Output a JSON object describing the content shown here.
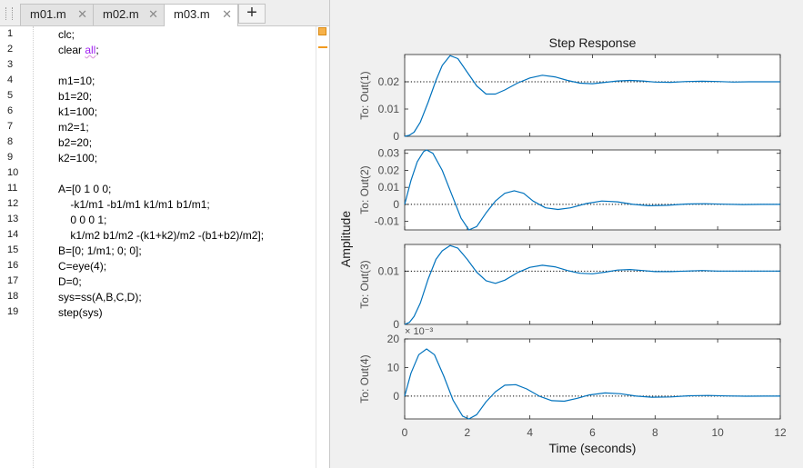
{
  "editor": {
    "tabs": [
      {
        "label": "m01.m",
        "active": false
      },
      {
        "label": "m02.m",
        "active": false
      },
      {
        "label": "m03.m",
        "active": true
      }
    ],
    "close_glyph": "✕",
    "add_tab_glyph": "+",
    "lines": [
      {
        "n": "1",
        "text": "clc;"
      },
      {
        "n": "2",
        "text": "clear ",
        "str": "all",
        "tail": ";"
      },
      {
        "n": "3",
        "text": ""
      },
      {
        "n": "4",
        "text": "m1=10;"
      },
      {
        "n": "5",
        "text": "b1=20;"
      },
      {
        "n": "6",
        "text": "k1=100;"
      },
      {
        "n": "7",
        "text": "m2=1;"
      },
      {
        "n": "8",
        "text": "b2=20;"
      },
      {
        "n": "9",
        "text": "k2=100;"
      },
      {
        "n": "10",
        "text": ""
      },
      {
        "n": "11",
        "text": "A=[0 1 0 0;"
      },
      {
        "n": "12",
        "text": "    -k1/m1 -b1/m1 k1/m1 b1/m1;"
      },
      {
        "n": "13",
        "text": "    0 0 0 1;"
      },
      {
        "n": "14",
        "text": "    k1/m2 b1/m2 -(k1+k2)/m2 -(b1+b2)/m2];"
      },
      {
        "n": "15",
        "text": "B=[0; 1/m1; 0; 0];"
      },
      {
        "n": "16",
        "text": "C=eye(4);"
      },
      {
        "n": "17",
        "text": "D=0;"
      },
      {
        "n": "18",
        "text": "sys=ss(A,B,C,D);"
      },
      {
        "n": "19",
        "text": "step(sys)"
      }
    ],
    "string_color": "#a020f0",
    "warning_color": "#f29a1e"
  },
  "chart_data": {
    "type": "line",
    "title": "Step Response",
    "xlabel": "Time (seconds)",
    "ylabel": "Amplitude",
    "xlim": [
      0,
      12
    ],
    "xticks": [
      "0",
      "2",
      "4",
      "6",
      "8",
      "10",
      "12"
    ],
    "line_color": "#0072bd",
    "steady_state_line": "dotted",
    "subplots": [
      {
        "name": "To: Out(1)",
        "ylim": [
          0,
          0.03
        ],
        "yticks": [
          {
            "v": 0,
            "label": "0"
          },
          {
            "v": 0.01,
            "label": "0.01"
          },
          {
            "v": 0.02,
            "label": "0.02"
          }
        ],
        "final_value": 0.02,
        "exponent_label": "",
        "points": [
          [
            0,
            0
          ],
          [
            0.15,
            0.0004
          ],
          [
            0.3,
            0.0015
          ],
          [
            0.5,
            0.0052
          ],
          [
            0.75,
            0.0125
          ],
          [
            1.0,
            0.0205
          ],
          [
            1.2,
            0.026
          ],
          [
            1.45,
            0.0296
          ],
          [
            1.7,
            0.0285
          ],
          [
            2.0,
            0.0235
          ],
          [
            2.3,
            0.0185
          ],
          [
            2.6,
            0.0155
          ],
          [
            2.9,
            0.0155
          ],
          [
            3.2,
            0.017
          ],
          [
            3.6,
            0.0195
          ],
          [
            4.0,
            0.0214
          ],
          [
            4.4,
            0.0224
          ],
          [
            4.8,
            0.0218
          ],
          [
            5.2,
            0.0205
          ],
          [
            5.6,
            0.0195
          ],
          [
            6.0,
            0.0193
          ],
          [
            6.4,
            0.0198
          ],
          [
            6.8,
            0.0203
          ],
          [
            7.2,
            0.0205
          ],
          [
            7.6,
            0.0203
          ],
          [
            8.0,
            0.0199
          ],
          [
            8.5,
            0.0198
          ],
          [
            9.0,
            0.0201
          ],
          [
            9.5,
            0.0202
          ],
          [
            10.0,
            0.0201
          ],
          [
            10.5,
            0.0199
          ],
          [
            11.0,
            0.02
          ],
          [
            11.5,
            0.02
          ],
          [
            12.0,
            0.02
          ]
        ]
      },
      {
        "name": "To: Out(2)",
        "ylim": [
          -0.015,
          0.032
        ],
        "yticks": [
          {
            "v": -0.01,
            "label": "-0.01"
          },
          {
            "v": 0,
            "label": "0"
          },
          {
            "v": 0.01,
            "label": "0.01"
          },
          {
            "v": 0.02,
            "label": "0.02"
          },
          {
            "v": 0.03,
            "label": "0.03"
          }
        ],
        "final_value": 0,
        "exponent_label": "",
        "points": [
          [
            0,
            0
          ],
          [
            0.2,
            0.014
          ],
          [
            0.4,
            0.025
          ],
          [
            0.6,
            0.031
          ],
          [
            0.7,
            0.032
          ],
          [
            0.9,
            0.03
          ],
          [
            1.2,
            0.02
          ],
          [
            1.5,
            0.006
          ],
          [
            1.8,
            -0.008
          ],
          [
            2.05,
            -0.015
          ],
          [
            2.3,
            -0.013
          ],
          [
            2.6,
            -0.005
          ],
          [
            2.9,
            0.002
          ],
          [
            3.2,
            0.0065
          ],
          [
            3.5,
            0.008
          ],
          [
            3.8,
            0.0065
          ],
          [
            4.1,
            0.002
          ],
          [
            4.5,
            -0.002
          ],
          [
            4.9,
            -0.003
          ],
          [
            5.3,
            -0.002
          ],
          [
            5.8,
            0.0005
          ],
          [
            6.3,
            0.002
          ],
          [
            6.8,
            0.0015
          ],
          [
            7.3,
            0
          ],
          [
            7.8,
            -0.0008
          ],
          [
            8.4,
            -0.0005
          ],
          [
            9.0,
            0.0002
          ],
          [
            9.6,
            0.0004
          ],
          [
            10.2,
            0.0001
          ],
          [
            10.8,
            -0.0001
          ],
          [
            11.4,
            0
          ],
          [
            12.0,
            0
          ]
        ]
      },
      {
        "name": "To: Out(3)",
        "ylim": [
          0,
          0.015
        ],
        "yticks": [
          {
            "v": 0,
            "label": "0"
          },
          {
            "v": 0.01,
            "label": "0.01"
          }
        ],
        "final_value": 0.01,
        "exponent_label": "",
        "points": [
          [
            0,
            0
          ],
          [
            0.15,
            0.0004
          ],
          [
            0.3,
            0.0015
          ],
          [
            0.5,
            0.004
          ],
          [
            0.75,
            0.0085
          ],
          [
            1.0,
            0.0122
          ],
          [
            1.2,
            0.0138
          ],
          [
            1.45,
            0.0148
          ],
          [
            1.7,
            0.0143
          ],
          [
            2.0,
            0.0122
          ],
          [
            2.3,
            0.0098
          ],
          [
            2.6,
            0.0082
          ],
          [
            2.9,
            0.0077
          ],
          [
            3.2,
            0.0083
          ],
          [
            3.6,
            0.0097
          ],
          [
            4.0,
            0.0107
          ],
          [
            4.4,
            0.0111
          ],
          [
            4.8,
            0.0108
          ],
          [
            5.2,
            0.0101
          ],
          [
            5.6,
            0.0096
          ],
          [
            6.0,
            0.0095
          ],
          [
            6.4,
            0.0098
          ],
          [
            6.8,
            0.0102
          ],
          [
            7.2,
            0.0103
          ],
          [
            7.6,
            0.0101
          ],
          [
            8.0,
            0.0099
          ],
          [
            8.5,
            0.0099
          ],
          [
            9.0,
            0.01
          ],
          [
            9.5,
            0.0101
          ],
          [
            10.0,
            0.01
          ],
          [
            10.5,
            0.01
          ],
          [
            11.0,
            0.01
          ],
          [
            11.5,
            0.01
          ],
          [
            12.0,
            0.01
          ]
        ]
      },
      {
        "name": "To: Out(4)",
        "ylim": [
          -8,
          20
        ],
        "yticks": [
          {
            "v": 0,
            "label": "0"
          },
          {
            "v": 10,
            "label": "10"
          },
          {
            "v": 20,
            "label": "20"
          }
        ],
        "final_value": 0,
        "exponent_label": "× 10⁻³",
        "points": [
          [
            0,
            0
          ],
          [
            0.2,
            8
          ],
          [
            0.45,
            14.5
          ],
          [
            0.7,
            16.5
          ],
          [
            0.95,
            14.5
          ],
          [
            1.25,
            7
          ],
          [
            1.55,
            -1.5
          ],
          [
            1.85,
            -7
          ],
          [
            2.05,
            -8
          ],
          [
            2.3,
            -6.5
          ],
          [
            2.6,
            -2
          ],
          [
            2.9,
            1.5
          ],
          [
            3.2,
            3.8
          ],
          [
            3.55,
            4
          ],
          [
            3.9,
            2.5
          ],
          [
            4.3,
            0
          ],
          [
            4.7,
            -1.6
          ],
          [
            5.1,
            -1.8
          ],
          [
            5.5,
            -0.8
          ],
          [
            5.9,
            0.4
          ],
          [
            6.4,
            1.1
          ],
          [
            6.9,
            0.8
          ],
          [
            7.4,
            0
          ],
          [
            7.9,
            -0.4
          ],
          [
            8.5,
            -0.3
          ],
          [
            9.1,
            0.1
          ],
          [
            9.7,
            0.2
          ],
          [
            10.3,
            0.05
          ],
          [
            10.9,
            -0.05
          ],
          [
            11.5,
            0
          ],
          [
            12.0,
            0
          ]
        ]
      }
    ]
  }
}
